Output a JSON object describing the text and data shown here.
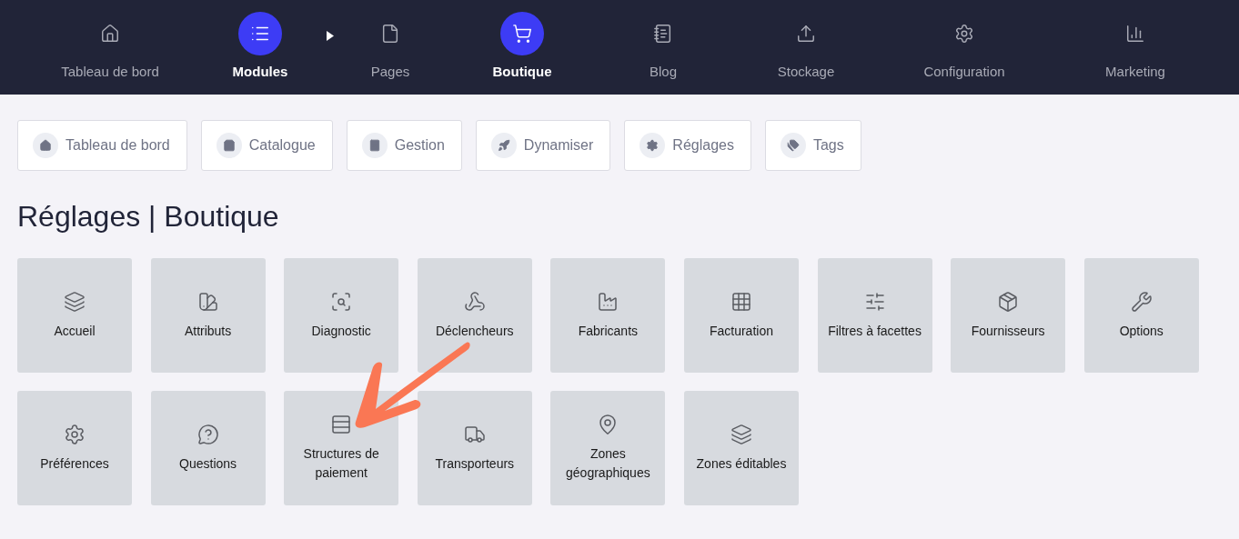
{
  "top_nav": [
    {
      "label": "Tableau de bord",
      "selected": false
    },
    {
      "label": "Modules",
      "selected": true
    },
    {
      "label": "Pages",
      "selected": false
    },
    {
      "label": "Boutique",
      "selected": true
    },
    {
      "label": "Blog",
      "selected": false
    },
    {
      "label": "Stockage",
      "selected": false
    },
    {
      "label": "Configuration",
      "selected": false
    },
    {
      "label": "Marketing",
      "selected": false
    }
  ],
  "sub_nav": [
    "Tableau de bord",
    "Catalogue",
    "Gestion",
    "Dynamiser",
    "Réglages",
    "Tags"
  ],
  "title": "Réglages | Boutique",
  "tiles": [
    "Accueil",
    "Attributs",
    "Diagnostic",
    "Déclencheurs",
    "Fabricants",
    "Facturation",
    "Filtres à facettes",
    "Fournisseurs",
    "Options",
    "Préférences",
    "Questions",
    "Structures de paiement",
    "Transporteurs",
    "Zones géographiques",
    "Zones éditables"
  ]
}
